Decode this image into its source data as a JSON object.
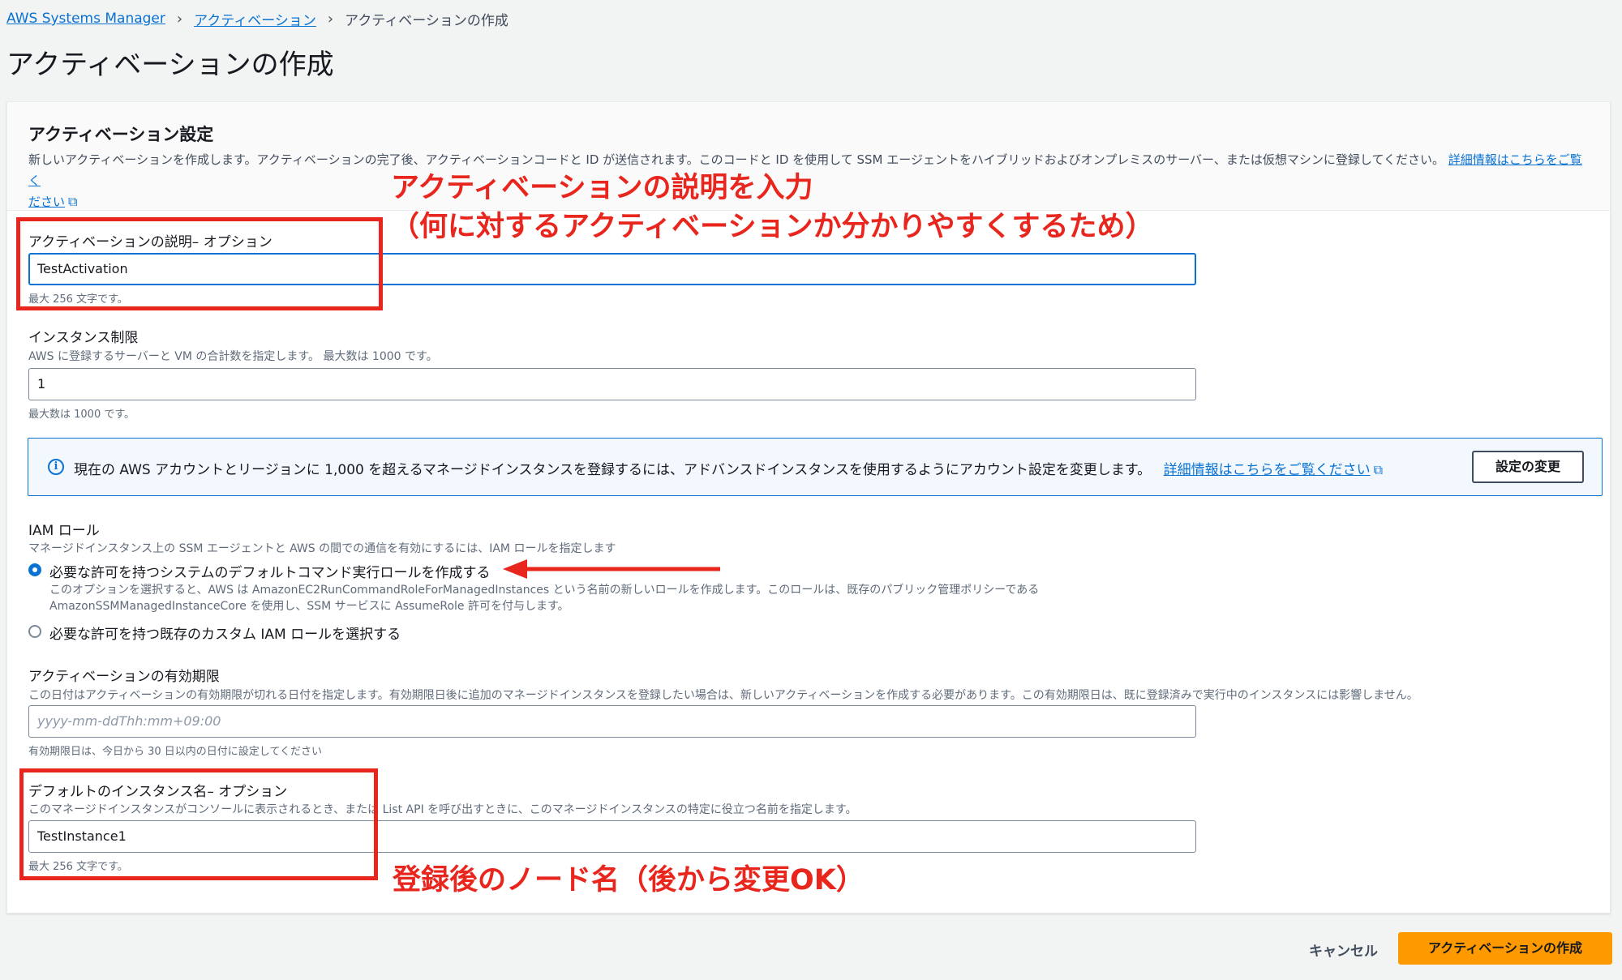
{
  "breadcrumb": {
    "items": [
      "AWS Systems Manager",
      "アクティベーション",
      "アクティベーションの作成"
    ]
  },
  "page_title": "アクティベーションの作成",
  "panel": {
    "title": "アクティベーション設定",
    "description_line1": "新しいアクティベーションを作成します。アクティベーションの完了後、アクティベーションコードと ID が送信されます。このコードと ID を使用して SSM エージェントをハイブリッドおよびオンプレミスのサーバー、または仮想マシンに登録してください。",
    "link_part1": "詳細情報はこちらをご覧く",
    "link_part2": "ださい"
  },
  "fields": {
    "description": {
      "label": "アクティベーションの説明– オプション",
      "value": "TestActivation",
      "hint": "最大 256 文字です。"
    },
    "instance_limit": {
      "label": "インスタンス制限",
      "description": "AWS に登録するサーバーと VM の合計数を指定します。 最大数は 1000 です。",
      "value": "1",
      "hint": "最大数は 1000 です。"
    },
    "iam_role": {
      "label": "IAM ロール",
      "description": "マネージドインスタンス上の SSM エージェントと AWS の間での通信を有効にするには、IAM ロールを指定します",
      "options": [
        {
          "label": "必要な許可を持つシステムのデフォルトコマンド実行ロールを作成する",
          "desc1": "このオプションを選択すると、AWS は AmazonEC2RunCommandRoleForManagedInstances という名前の新しいロールを作成します。このロールは、既存のパブリック管理ポリシーである",
          "desc2": "AmazonSSMManagedInstanceCore を使用し、SSM サービスに AssumeRole 許可を付与します。",
          "selected": true
        },
        {
          "label": "必要な許可を持つ既存のカスタム IAM ロールを選択する",
          "selected": false
        }
      ]
    },
    "expiration": {
      "label": "アクティベーションの有効期限",
      "description": "この日付はアクティベーションの有効期限が切れる日付を指定します。有効期限日後に追加のマネージドインスタンスを登録したい場合は、新しいアクティベーションを作成する必要があります。この有効期限日は、既に登録済みで実行中のインスタンスには影響しません。",
      "placeholder": "yyyy-mm-ddThh:mm+09:00",
      "hint": "有効期限日は、今日から 30 日以内の日付に設定してください"
    },
    "default_instance_name": {
      "label": "デフォルトのインスタンス名– オプション",
      "description": "このマネージドインスタンスがコンソールに表示されるとき、または List API を呼び出すときに、このマネージドインスタンスの特定に役立つ名前を指定します。",
      "value": "TestInstance1",
      "hint": "最大 256 文字です。"
    }
  },
  "info_alert": {
    "text": "現在の AWS アカウントとリージョンに 1,000 を超えるマネージドインスタンスを登録するには、アドバンスドインスタンスを使用するようにアカウント設定を変更します。",
    "link": "詳細情報はこちらをご覧ください",
    "button": "設定の変更"
  },
  "annotations": {
    "desc_line1": "アクティベーションの説明を入力",
    "desc_line2": "（何に対するアクティベーションか分かりやすくするため）",
    "name_note": "登録後のノード名（後から変更OK）",
    "color": "#e8261d"
  },
  "footer": {
    "cancel": "キャンセル",
    "submit": "アクティベーションの作成"
  },
  "colors": {
    "link": "#0972d3",
    "primary_button": "#ff9900",
    "annotation": "#e8261d"
  }
}
